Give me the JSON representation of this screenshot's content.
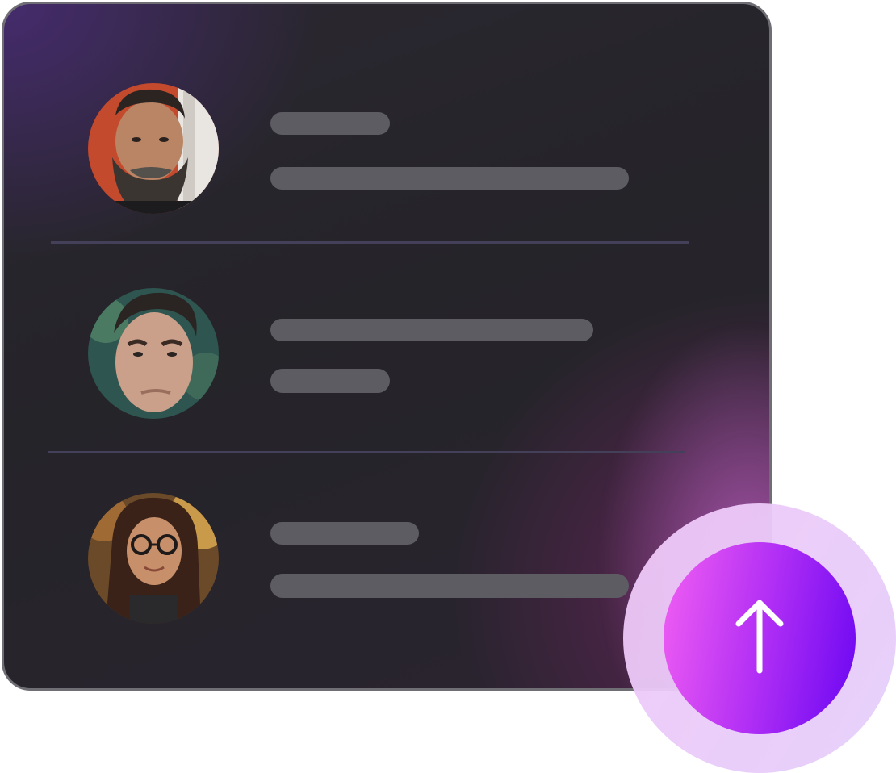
{
  "contacts": [
    {
      "name": "",
      "detail": "",
      "avatar_icon": "person-bearded-avatar"
    },
    {
      "name": "",
      "detail": "",
      "avatar_icon": "person-man-avatar"
    },
    {
      "name": "",
      "detail": "",
      "avatar_icon": "person-woman-glasses-avatar"
    }
  ],
  "upload": {
    "icon": "arrow-up-icon",
    "label": ""
  },
  "colors": {
    "card_bg": "#252429",
    "card_border": "#6f6e74",
    "placeholder_bar": "#5d5c63",
    "divider": "#44405a",
    "accent_start": "#f25ff2",
    "accent_end": "#6a06f2",
    "halo": "#ecd4f8"
  }
}
